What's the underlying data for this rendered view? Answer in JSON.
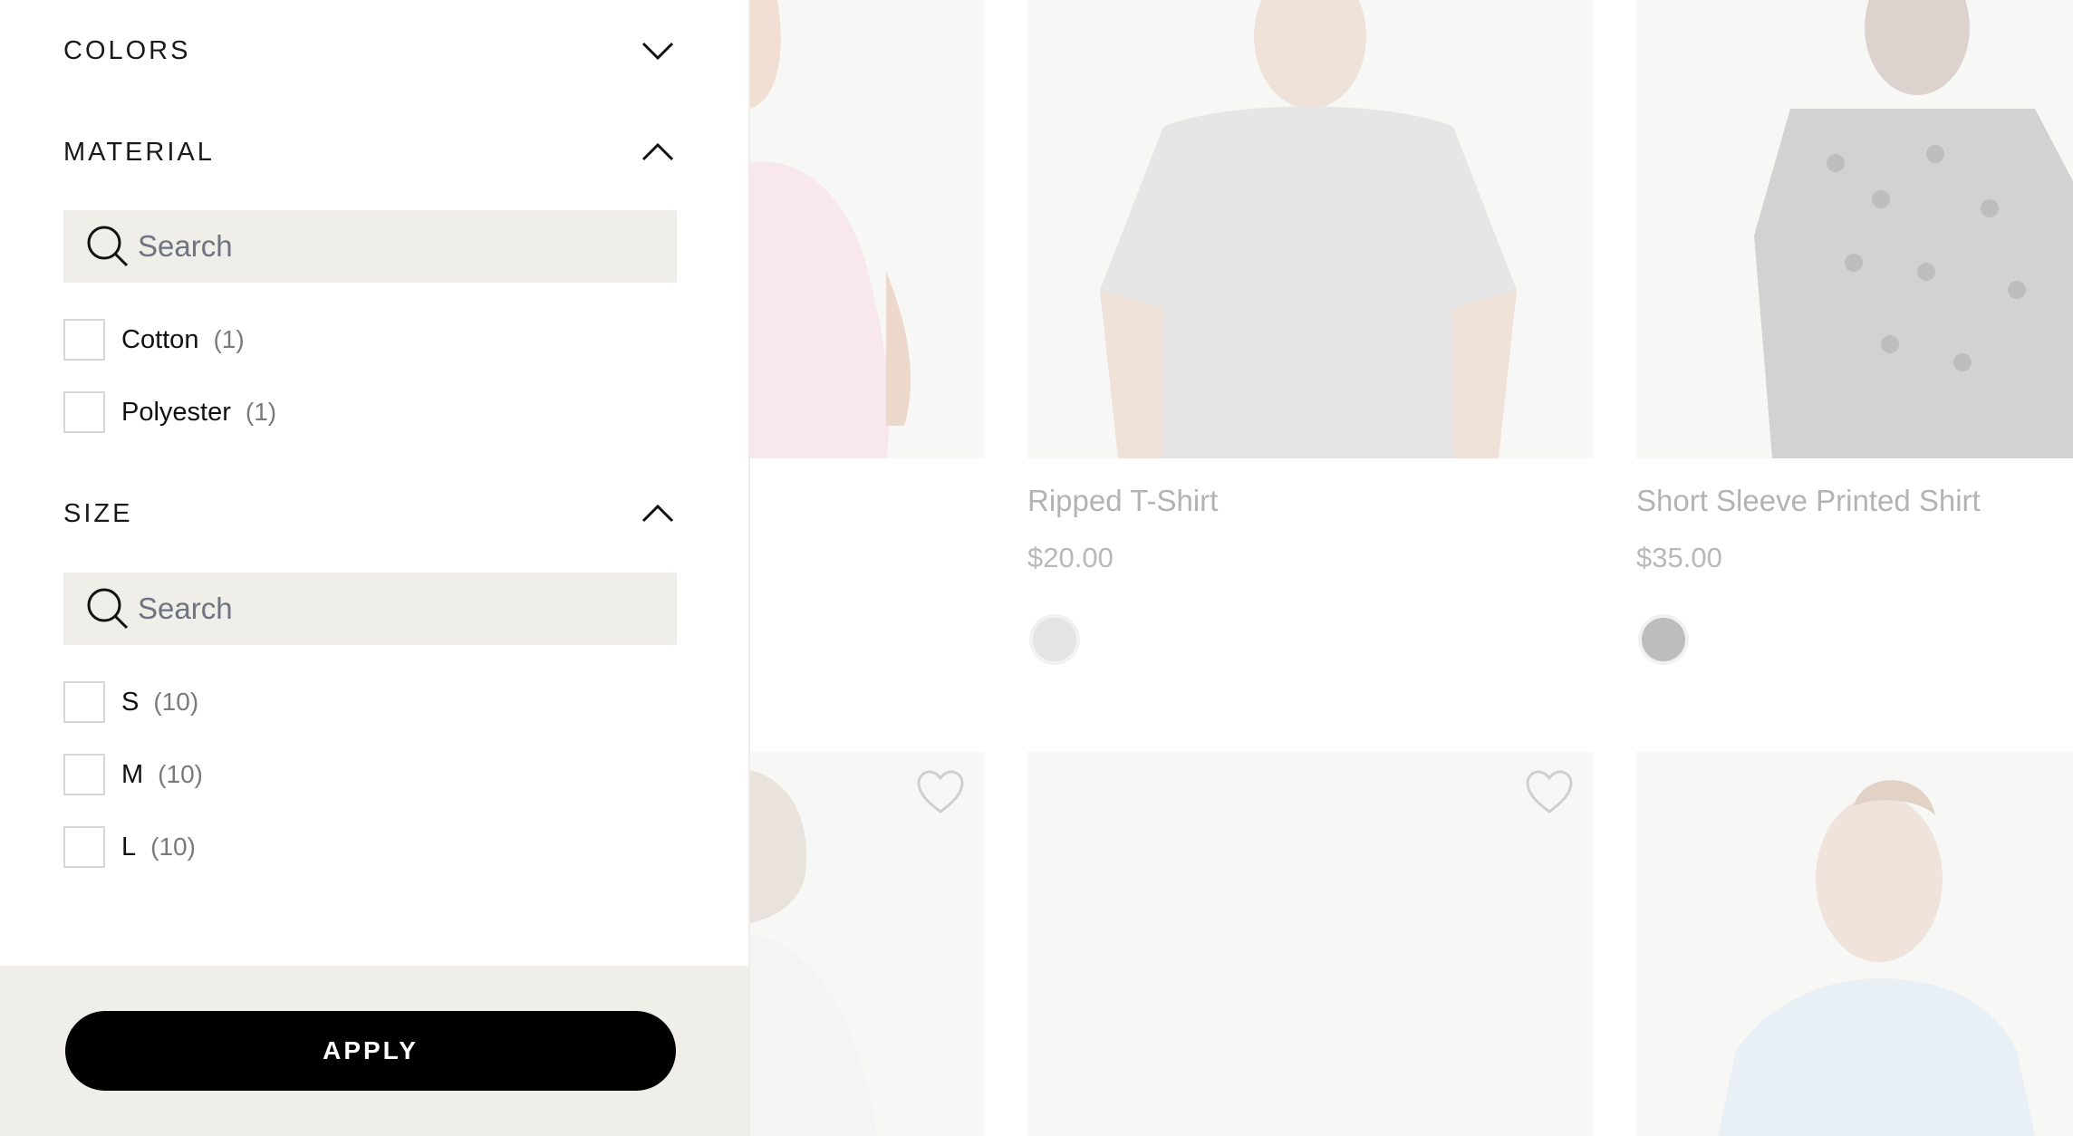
{
  "filters": {
    "colors": {
      "title": "COLORS",
      "icon": "chevron-down-icon"
    },
    "material": {
      "title": "MATERIAL",
      "icon": "chevron-up-icon",
      "search_placeholder": "Search",
      "options": [
        {
          "label": "Cotton",
          "count": "(1)"
        },
        {
          "label": "Polyester",
          "count": "(1)"
        }
      ]
    },
    "size": {
      "title": "SIZE",
      "icon": "chevron-up-icon",
      "search_placeholder": "Search",
      "options": [
        {
          "label": "S",
          "count": "(10)"
        },
        {
          "label": "M",
          "count": "(10)"
        },
        {
          "label": "L",
          "count": "(10)"
        }
      ]
    },
    "apply_label": "APPLY"
  },
  "products": [
    {
      "title": "Ripped T-Shirt",
      "price": "$20.00",
      "swatch_color": "#e4e4e4"
    },
    {
      "title": "Short Sleeve Printed Shirt",
      "price": "$35.00",
      "swatch_color": "#bdbdbd"
    }
  ],
  "colors": {
    "drawer_bg": "#ffffff",
    "panel_bg": "#efeee9",
    "apply_bg": "#000000",
    "apply_text": "#ffffff"
  }
}
